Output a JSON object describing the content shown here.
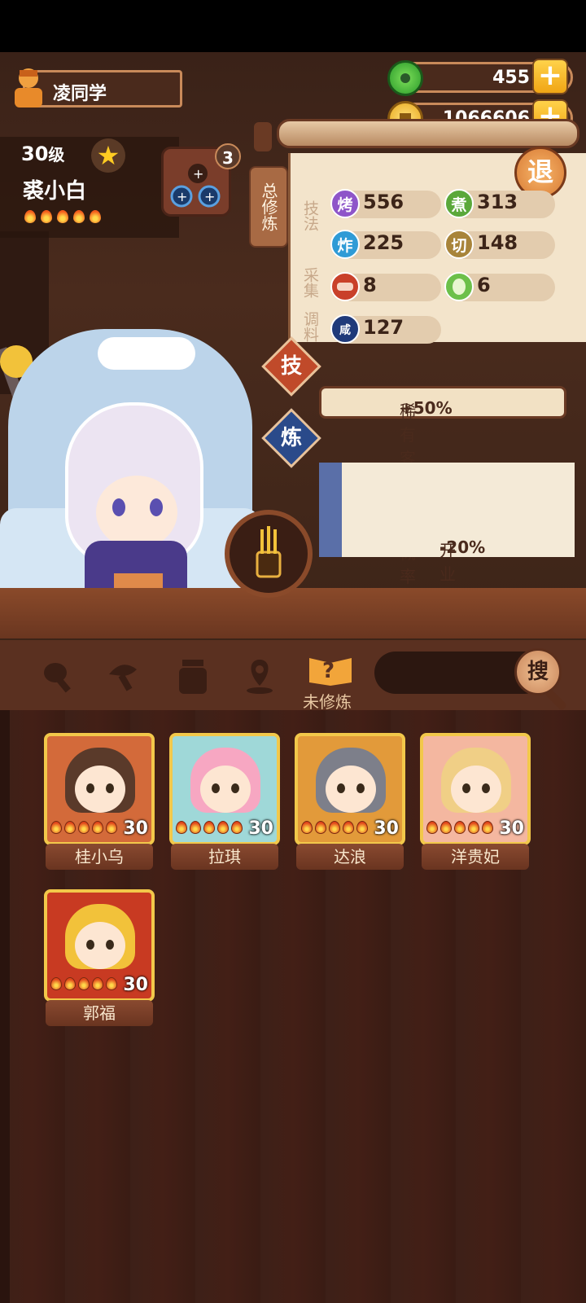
{
  "player": {
    "name": "凌同学"
  },
  "currency": {
    "jade": "455",
    "coins": "1066606"
  },
  "chef": {
    "level": "30",
    "level_unit": "级",
    "name": "裘小白",
    "stars": 5
  },
  "equipment": {
    "count": "3"
  },
  "panel": {
    "total_tab": "总修炼",
    "back_button": "退",
    "groups": {
      "technique": "技法",
      "gather": "采集",
      "seasoning": "调料"
    },
    "stats": [
      {
        "icon": "烤",
        "value": "556",
        "color": "#8e55c9"
      },
      {
        "icon": "煮",
        "value": "313",
        "color": "#5aa83a"
      },
      {
        "icon": "炸",
        "value": "225",
        "color": "#2f9bd6"
      },
      {
        "icon": "切",
        "value": "148",
        "color": "#a8843a"
      },
      {
        "icon": "meat",
        "value": "8",
        "color": "#c9402a"
      },
      {
        "icon": "veg",
        "value": "6",
        "color": "#6cc04a"
      },
      {
        "icon": "咸",
        "value": "127",
        "color": "#1f3a7a"
      }
    ]
  },
  "badges": {
    "skill": "技",
    "refine": "炼"
  },
  "effects": {
    "rare": {
      "text": "稀有客人出现概率",
      "value": "+50%"
    },
    "time": {
      "text": "开业时间",
      "value": "-20%"
    }
  },
  "filters": {
    "active_label": "未修炼",
    "search": "搜"
  },
  "chefs": [
    {
      "name": "桂小乌",
      "level": "30",
      "bg": "#d36a3a",
      "hair": "#5a3a2a"
    },
    {
      "name": "拉琪",
      "level": "30",
      "bg": "#9fd8d8",
      "hair": "#f7a7c2"
    },
    {
      "name": "达浪",
      "level": "30",
      "bg": "#e29a3a",
      "hair": "#7d7f8a"
    },
    {
      "name": "洋贵妃",
      "level": "30",
      "bg": "#f4b7a0",
      "hair": "#f0cf86"
    },
    {
      "name": "郭福",
      "level": "30",
      "bg": "#c83a22",
      "hair": "#f2c23a"
    }
  ]
}
